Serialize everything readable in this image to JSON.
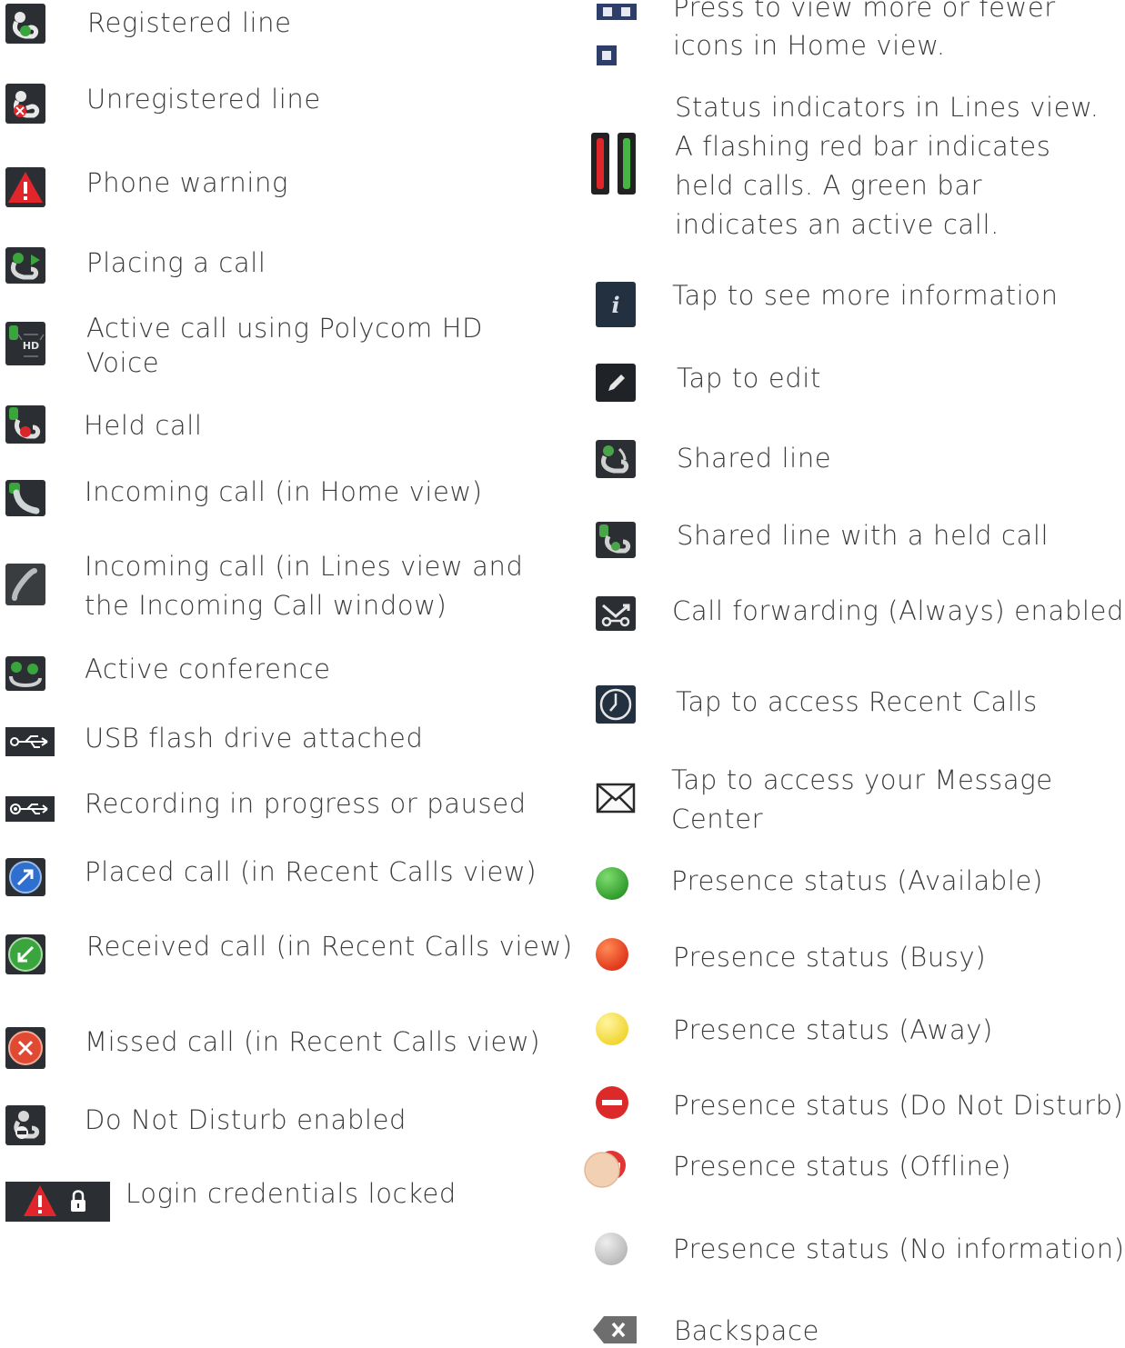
{
  "left_column": [
    {
      "icon": "registered-line-icon",
      "label": "Registered line"
    },
    {
      "icon": "unregistered-line-icon",
      "label": "Unregistered line"
    },
    {
      "icon": "warning-icon",
      "label": "Phone warning"
    },
    {
      "icon": "placing-call-icon",
      "label": "Placing a call"
    },
    {
      "icon": "hd-voice-icon",
      "label": "Active call using Polycom HD",
      "label2": "Voice"
    },
    {
      "icon": "held-call-icon",
      "label": "Held call"
    },
    {
      "icon": "incoming-call-home-icon",
      "label": "Incoming call (in Home view)"
    },
    {
      "icon": "incoming-call-lines-icon",
      "label": "Incoming call (in Lines view and",
      "label2": "the Incoming Call window)"
    },
    {
      "icon": "conference-icon",
      "label": "Active conference"
    },
    {
      "icon": "usb-icon",
      "label": "USB flash drive attached"
    },
    {
      "icon": "recording-icon",
      "label": "Recording in progress or paused"
    },
    {
      "icon": "placed-call-icon",
      "label": "Placed call (in Recent Calls view)"
    },
    {
      "icon": "received-call-icon",
      "label": "Received call (in Recent Calls view)"
    },
    {
      "icon": "missed-call-icon",
      "label": "Missed call (in Recent Calls view)"
    },
    {
      "icon": "do-not-disturb-icon",
      "label": "Do Not Disturb enabled"
    },
    {
      "icon": "login-locked-icon",
      "label": "Login credentials locked"
    }
  ],
  "right_column": [
    {
      "icon": "view-toggle-icon",
      "label": "Press to view more or fewer",
      "label2": "icons in Home view."
    },
    {
      "icon": "status-bars-icon",
      "lines": [
        "Status indicators in Lines view.",
        "A flashing red bar indicates",
        "held calls. A green bar",
        "indicates an active call."
      ]
    },
    {
      "icon": "info-icon",
      "label": "Tap to see more information"
    },
    {
      "icon": "edit-icon",
      "label": "Tap to edit"
    },
    {
      "icon": "shared-line-icon",
      "label": "Shared line"
    },
    {
      "icon": "shared-line-held-icon",
      "label": "Shared line with a held call"
    },
    {
      "icon": "call-forwarding-icon",
      "label": "Call forwarding (Always) enabled"
    },
    {
      "icon": "clock-icon",
      "label": "Tap to access Recent Calls"
    },
    {
      "icon": "envelope-icon",
      "label": "Tap to access your Message",
      "label2": "Center"
    },
    {
      "icon": "presence-available-icon",
      "label": "Presence status (Available)",
      "color": "#3fae3a"
    },
    {
      "icon": "presence-busy-icon",
      "label": "Presence status (Busy)",
      "color": "#e8461d"
    },
    {
      "icon": "presence-away-icon",
      "label": "Presence status (Away)",
      "color": "#f4df47"
    },
    {
      "icon": "presence-dnd-icon",
      "label": "Presence status (Do Not Disturb)",
      "color": "#df2b2b"
    },
    {
      "icon": "presence-offline-icon",
      "label": "Presence status (Offline)",
      "color": "#f0c9a8"
    },
    {
      "icon": "presence-noinfo-icon",
      "label": "Presence status (No information)",
      "color": "#c9c9c9"
    },
    {
      "icon": "backspace-icon",
      "label": "Backspace"
    }
  ],
  "login_locked_icon_glyph": "🔒"
}
